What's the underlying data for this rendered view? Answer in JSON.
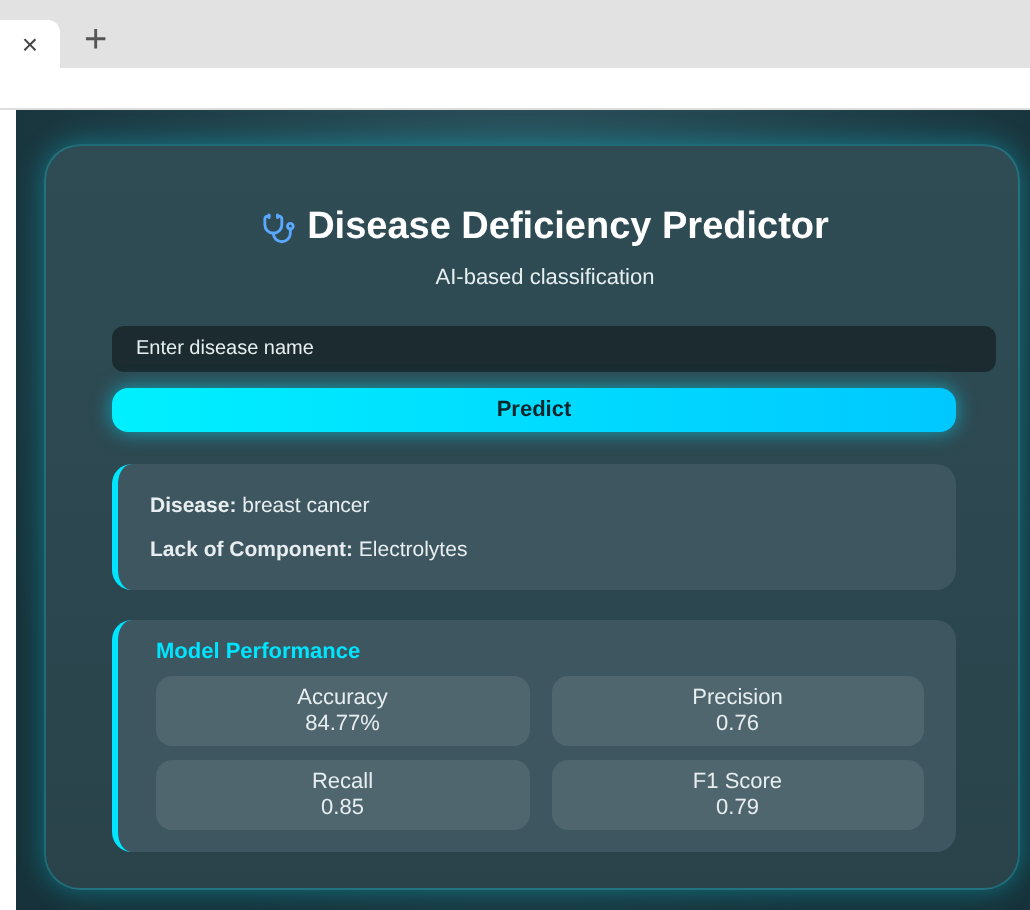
{
  "browser": {
    "tab_close": "×",
    "new_tab": "+"
  },
  "app": {
    "title": "Disease Deficiency Predictor",
    "subtitle": "AI-based classification"
  },
  "search": {
    "placeholder": "Enter disease name"
  },
  "predict_button": "Predict",
  "result": [
    {
      "label": "Disease:",
      "value": "breast cancer"
    },
    {
      "label": "Lack of Component:",
      "value": "Electrolytes"
    }
  ],
  "performance": {
    "title": "Model Performance",
    "metrics": [
      {
        "name": "Accuracy",
        "value": "84.77%"
      },
      {
        "name": "Precision",
        "value": "0.76"
      },
      {
        "name": "Recall",
        "value": "0.85"
      },
      {
        "name": "F1 Score",
        "value": "0.79"
      }
    ]
  }
}
